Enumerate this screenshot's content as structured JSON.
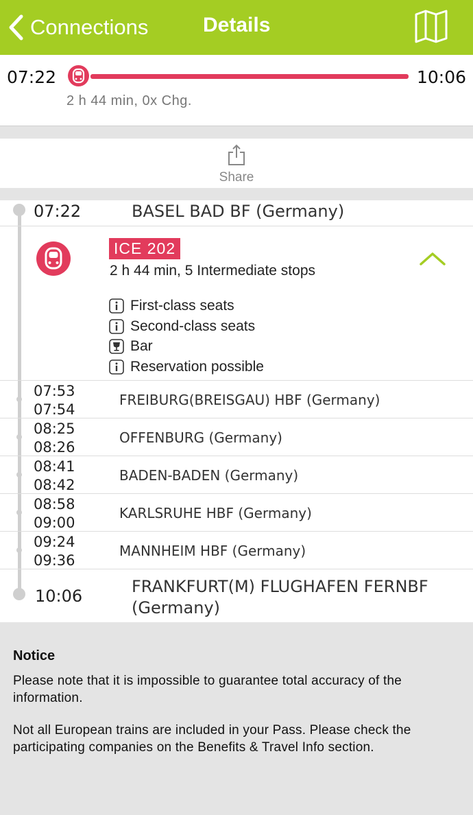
{
  "navbar": {
    "back_label": "Connections",
    "title": "Details",
    "map_icon": "map-icon",
    "background": "#a4cd23"
  },
  "summary": {
    "departure": "07:22",
    "arrival": "10:06",
    "info": "2 h 44 min, 0x Chg.",
    "accent": "#e23b5c"
  },
  "share": {
    "label": "Share"
  },
  "journey": {
    "departure": {
      "time": "07:22",
      "station": "BASEL BAD BF (Germany)"
    },
    "train": {
      "name": "ICE 202",
      "subtitle": "2 h 44 min, 5 Intermediate stops",
      "features": [
        {
          "icon": "info-icon",
          "label": "First-class seats"
        },
        {
          "icon": "info-icon",
          "label": "Second-class seats"
        },
        {
          "icon": "bar-icon",
          "label": "Bar"
        },
        {
          "icon": "info-icon",
          "label": "Reservation possible"
        }
      ]
    },
    "stops": [
      {
        "arr": "07:53",
        "dep": "07:54",
        "station": "FREIBURG(BREISGAU) HBF (Germany)"
      },
      {
        "arr": "08:25",
        "dep": "08:26",
        "station": "OFFENBURG (Germany)"
      },
      {
        "arr": "08:41",
        "dep": "08:42",
        "station": "BADEN-BADEN (Germany)"
      },
      {
        "arr": "08:58",
        "dep": "09:00",
        "station": "KARLSRUHE HBF (Germany)"
      },
      {
        "arr": "09:24",
        "dep": "09:36",
        "station": "MANNHEIM HBF (Germany)"
      }
    ],
    "arrival": {
      "time": "10:06",
      "station": "FRANKFURT(M) FLUGHAFEN FERNBF (Germany)"
    }
  },
  "notice": {
    "title": "Notice",
    "paragraph1": "Please note that it is impossible to guarantee total accuracy of the information.",
    "paragraph2": "Not all European trains are included in your Pass. Please check the participating companies on the Benefits & Travel Info section."
  }
}
